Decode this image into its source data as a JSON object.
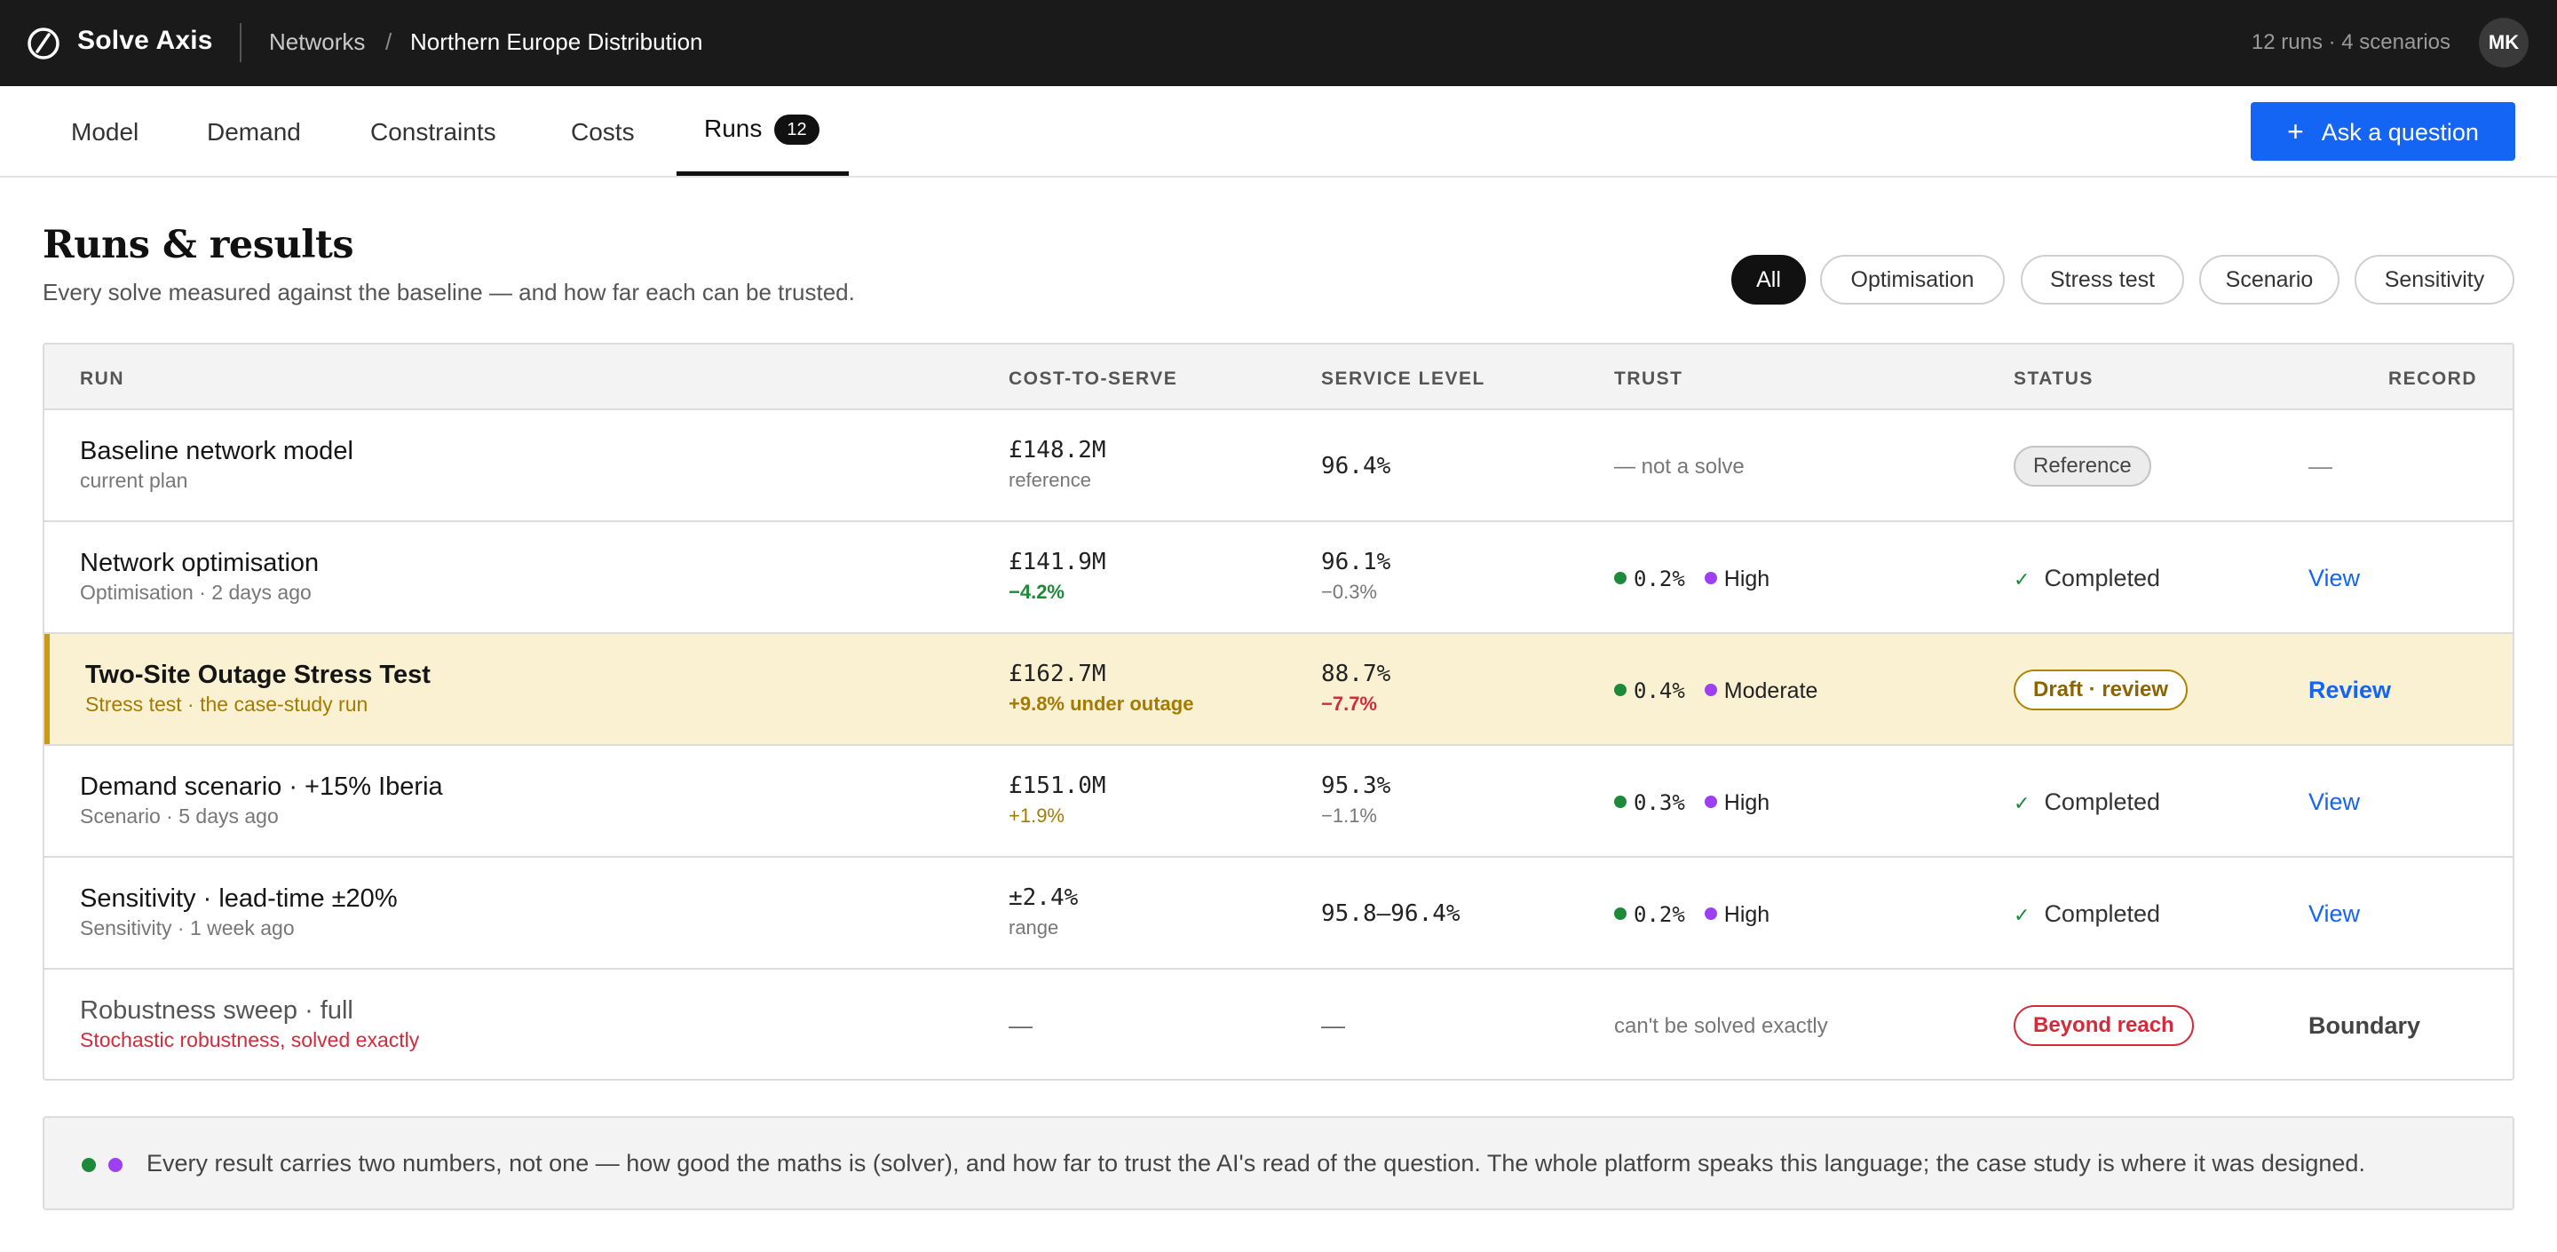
{
  "app": {
    "brand": "Solve Axis",
    "breadcrumb": [
      "Networks",
      "Northern Europe Distribution"
    ],
    "breadcrumb_separator": "/",
    "meta": "12 runs · 4 scenarios",
    "avatar_initials": "MK"
  },
  "tabs": [
    {
      "label": "Model"
    },
    {
      "label": "Demand"
    },
    {
      "label": "Constraints"
    },
    {
      "label": "Costs"
    },
    {
      "label": "Runs",
      "count": "12",
      "active": true
    }
  ],
  "ask_button": {
    "icon": "+",
    "label": "Ask a question"
  },
  "page": {
    "title": "Runs & results",
    "subtitle": "Every solve measured against the baseline — and how far each can be trusted."
  },
  "filters": [
    "All",
    "Optimisation",
    "Stress test",
    "Scenario",
    "Sensitivity"
  ],
  "table": {
    "headers": [
      "RUN",
      "COST-TO-SERVE",
      "SERVICE LEVEL",
      "TRUST",
      "STATUS",
      "RECORD"
    ],
    "rows": [
      {
        "name": "Baseline network model",
        "sub": "current plan",
        "cost": "£148.2M",
        "cost_sub": "reference",
        "service": "96.4%",
        "service_sub": "",
        "trust_text": "— not a solve",
        "status": "Reference",
        "record": "—"
      },
      {
        "name": "Network optimisation",
        "sub": "Optimisation · 2 days ago",
        "cost": "£141.9M",
        "cost_sub": "−4.2%",
        "service": "96.1%",
        "service_sub": "−0.3%",
        "trust_solver": "0.2%",
        "trust_ai": "High",
        "status": "Completed",
        "record": "View"
      },
      {
        "name": "Two-Site Outage Stress Test",
        "sub": "Stress test · the case-study run",
        "cost": "£162.7M",
        "cost_sub": "+9.8% under outage",
        "service": "88.7%",
        "service_sub": "−7.7%",
        "trust_solver": "0.4%",
        "trust_ai": "Moderate",
        "status": "Draft · review",
        "record": "Review"
      },
      {
        "name": "Demand scenario · +15% Iberia",
        "sub": "Scenario · 5 days ago",
        "cost": "£151.0M",
        "cost_sub": "+1.9%",
        "service": "95.3%",
        "service_sub": "−1.1%",
        "trust_solver": "0.3%",
        "trust_ai": "High",
        "status": "Completed",
        "record": "View"
      },
      {
        "name": "Sensitivity · lead-time ±20%",
        "sub": "Sensitivity · 1 week ago",
        "cost": "±2.4%",
        "cost_sub": "range",
        "service": "95.8–96.4%",
        "service_sub": "",
        "trust_solver": "0.2%",
        "trust_ai": "High",
        "status": "Completed",
        "record": "View"
      },
      {
        "name": "Robustness sweep · full",
        "sub": "Stochastic robustness, solved exactly",
        "cost": "—",
        "cost_sub": "",
        "service": "—",
        "service_sub": "",
        "trust_text": "can't be solved exactly",
        "status": "Beyond reach",
        "record": "Boundary"
      }
    ]
  },
  "note": {
    "text": "Every result carries two numbers, not one — how good the maths is (solver), and how far to trust the AI's read of the question. The whole platform speaks this language; the case study is where it was designed."
  },
  "colors": {
    "accent_blue": "#1565f5",
    "solver_dot": "#1d8a3a",
    "ai_dot": "#9d3ff2",
    "highlight_row": "#faf1d3",
    "error_red": "#d42a3a"
  },
  "icons": {
    "logo": "slashed-circle-icon",
    "completed": "check-icon",
    "ask": "plus-icon"
  }
}
